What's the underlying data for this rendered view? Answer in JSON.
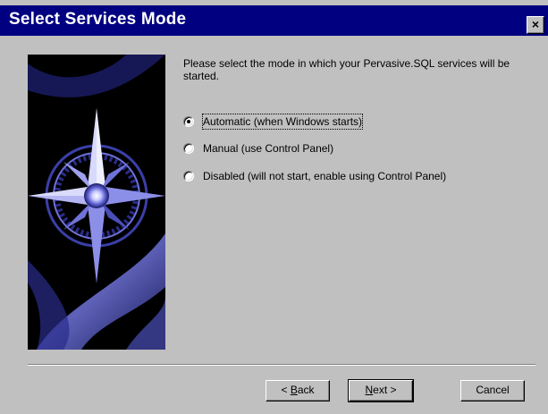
{
  "window": {
    "title": "Select Services Mode",
    "close_glyph": "×"
  },
  "content": {
    "prompt": "Please select the mode in which your Pervasive.SQL services will be started.",
    "options": [
      {
        "label": "Automatic (when Windows starts)",
        "selected": true
      },
      {
        "label": "Manual (use Control Panel)",
        "selected": false
      },
      {
        "label": "Disabled (will not start, enable using Control Panel)",
        "selected": false
      }
    ]
  },
  "buttons": {
    "back": {
      "mnemonic": "B",
      "rest": "ack",
      "prefix": "< "
    },
    "next": {
      "mnemonic": "N",
      "rest": "ext >"
    },
    "cancel": "Cancel"
  },
  "colors": {
    "title_bar": "#000080",
    "dialog_bg": "#c0c0c0",
    "graphic_glow": "#6f73d8"
  }
}
